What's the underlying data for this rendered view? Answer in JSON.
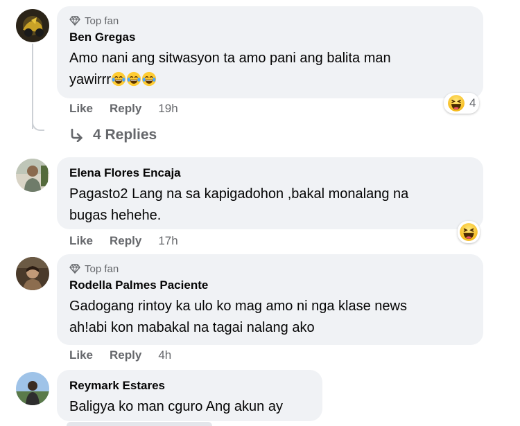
{
  "comments": [
    {
      "badge": "Top fan",
      "name": "Ben Gregas",
      "text_line1": "Amo nani ang sitwasyon ta amo pani ang balita man",
      "text_line2": "yawirrr",
      "like": "Like",
      "reply": "Reply",
      "time": "19h",
      "reaction_count": "4"
    },
    {
      "name": "Elena Flores Encaja",
      "text_line1": "Pagasto2 Lang na sa kapigadohon ,bakal monalang na",
      "text_line2": "bugas hehehe.",
      "like": "Like",
      "reply": "Reply",
      "time": "17h"
    },
    {
      "badge": "Top fan",
      "name": "Rodella Palmes Paciente",
      "text_line1": "Gadogang rintoy ka ulo ko mag amo ni nga klase news",
      "text_line2": "ah!abi kon mabakal na tagai nalang ako",
      "like": "Like",
      "reply": "Reply",
      "time": "4h"
    },
    {
      "name": "Reymark Estares",
      "text_line1": "Baligya ko man cguro Ang akun ay"
    }
  ],
  "replies_label": "4 Replies",
  "colors": {
    "bubble": "#f0f2f5",
    "meta": "#65676b",
    "text": "#050505"
  },
  "icons": [
    "diamond-icon",
    "reply-arrow-icon",
    "haha-emoji-icon",
    "crying-laughing-emoji-icon"
  ]
}
